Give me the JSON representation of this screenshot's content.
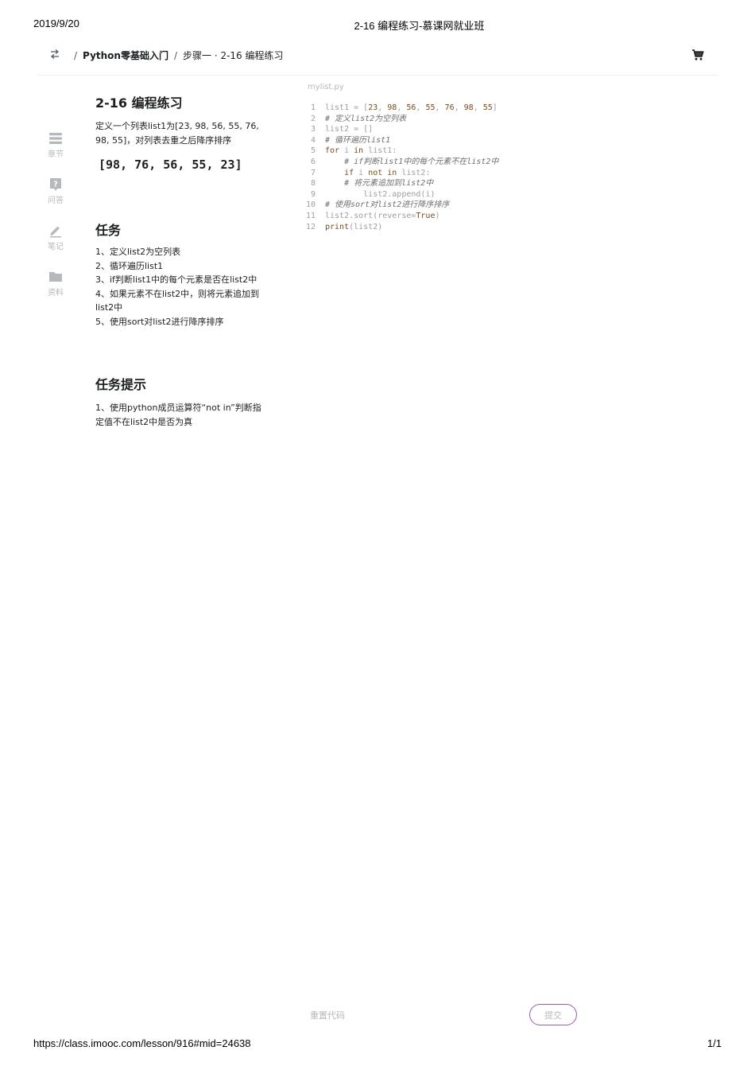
{
  "print_header": {
    "date": "2019/9/20",
    "title": "2-16 编程练习-慕课网就业班"
  },
  "print_footer": {
    "url": "https://class.imooc.com/lesson/916#mid=24638",
    "page": "1/1"
  },
  "topbar": {
    "back_icon": "switch-arrows-icon",
    "breadcrumb": {
      "separator": "/",
      "course": "Python零基础入门",
      "step": "步骤一 · 2-16 编程练习"
    },
    "cart_icon": "shopping-cart-icon"
  },
  "sidenav": {
    "items": [
      {
        "label": "章节",
        "icon": "chapters-icon"
      },
      {
        "label": "问答",
        "icon": "question-icon"
      },
      {
        "label": "笔记",
        "icon": "pencil-icon"
      },
      {
        "label": "资料",
        "icon": "folder-icon"
      }
    ]
  },
  "exercise": {
    "title": "2-16 编程练习",
    "description": "定义一个列表list1为[23, 98, 56, 55, 76, 98, 55]，对列表去重之后降序排序",
    "output": "[98, 76, 56, 55, 23]",
    "task_title": "任务",
    "tasks": [
      "1、定义list2为空列表",
      "2、循环遍历list1",
      "3、if判断list1中的每个元素是否在list2中",
      "4、如果元素不在list2中，则将元素追加到list2中",
      "5、使用sort对list2进行降序排序"
    ],
    "hint_title": "任务提示",
    "hint": "1、使用python成员运算符“not in”判断指定值不在list2中是否为真"
  },
  "editor": {
    "file_name": "mylist.py",
    "lines": [
      {
        "n": "1",
        "segs": [
          [
            "tx",
            "list1 = ["
          ],
          [
            "num",
            "23"
          ],
          [
            "tx",
            ", "
          ],
          [
            "num",
            "98"
          ],
          [
            "tx",
            ", "
          ],
          [
            "num",
            "56"
          ],
          [
            "tx",
            ", "
          ],
          [
            "num",
            "55"
          ],
          [
            "tx",
            ", "
          ],
          [
            "num",
            "76"
          ],
          [
            "tx",
            ", "
          ],
          [
            "num",
            "98"
          ],
          [
            "tx",
            ", "
          ],
          [
            "num",
            "55"
          ],
          [
            "tx",
            "]"
          ]
        ]
      },
      {
        "n": "2",
        "segs": [
          [
            "cm",
            "# 定义list2为空列表"
          ]
        ]
      },
      {
        "n": "3",
        "segs": [
          [
            "tx",
            "list2 = []"
          ]
        ]
      },
      {
        "n": "4",
        "segs": [
          [
            "cm",
            "# 循环遍历list1"
          ]
        ]
      },
      {
        "n": "5",
        "segs": [
          [
            "kw",
            "for"
          ],
          [
            "tx",
            " i "
          ],
          [
            "kw",
            "in"
          ],
          [
            "tx",
            " list1:"
          ]
        ]
      },
      {
        "n": "6",
        "segs": [
          [
            "tx",
            "    "
          ],
          [
            "cm",
            "# if判断list1中的每个元素不在list2中"
          ]
        ]
      },
      {
        "n": "7",
        "segs": [
          [
            "tx",
            "    "
          ],
          [
            "kw",
            "if"
          ],
          [
            "tx",
            " i "
          ],
          [
            "kw",
            "not in"
          ],
          [
            "tx",
            " list2:"
          ]
        ]
      },
      {
        "n": "8",
        "segs": [
          [
            "tx",
            "    "
          ],
          [
            "cm",
            "# 将元素追加到list2中"
          ]
        ]
      },
      {
        "n": "9",
        "segs": [
          [
            "tx",
            "        list2.append(i)"
          ]
        ]
      },
      {
        "n": "10",
        "segs": [
          [
            "cm",
            "# 使用sort对list2进行降序排序"
          ]
        ]
      },
      {
        "n": "11",
        "segs": [
          [
            "tx",
            "list2.sort(reverse="
          ],
          [
            "kw",
            "True"
          ],
          [
            "tx",
            ")"
          ]
        ]
      },
      {
        "n": "12",
        "segs": [
          [
            "kw",
            "print"
          ],
          [
            "tx",
            "(list2)"
          ]
        ]
      }
    ]
  },
  "actions": {
    "reset_label": "重置代码",
    "submit_label": "提交"
  },
  "colors": {
    "accent_border": "#9b59b6",
    "muted_text": "#b5b9bc",
    "code_keyword": "#7a4b1c"
  }
}
